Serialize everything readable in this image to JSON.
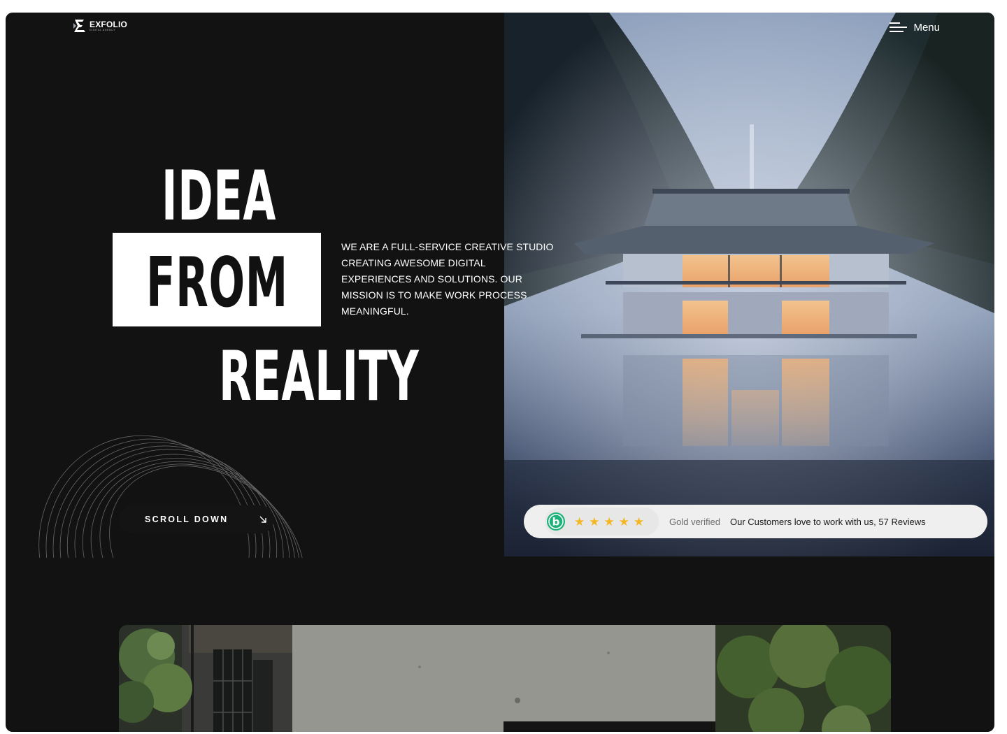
{
  "brand": {
    "name": "EXFOLIO",
    "tagline": "DIGITAL AGENCY"
  },
  "menu": {
    "label": "Menu"
  },
  "hero": {
    "line1": "IDEA",
    "line2": "FROM",
    "line3": "REALITY",
    "description": "WE ARE A FULL-SERVICE CREATIVE STUDIO CREATING AWESOME DIGITAL EXPERIENCES AND SOLUTIONS. OUR MISSION IS TO MAKE WORK PROCESS MEANINGFUL."
  },
  "scroll": {
    "label": "SCROLL DOWN"
  },
  "review": {
    "logo_letter": "b",
    "rating": 5,
    "stars": [
      "★",
      "★",
      "★",
      "★",
      "★"
    ],
    "badge": "Gold verified",
    "text": "Our Customers love to work with us, 57 Reviews"
  },
  "colors": {
    "background": "#121212",
    "accent_green": "#1db27a",
    "star": "#f3b723"
  },
  "icons": {
    "menu": "menu-lines-icon",
    "scroll": "arrow-down-right-icon"
  }
}
